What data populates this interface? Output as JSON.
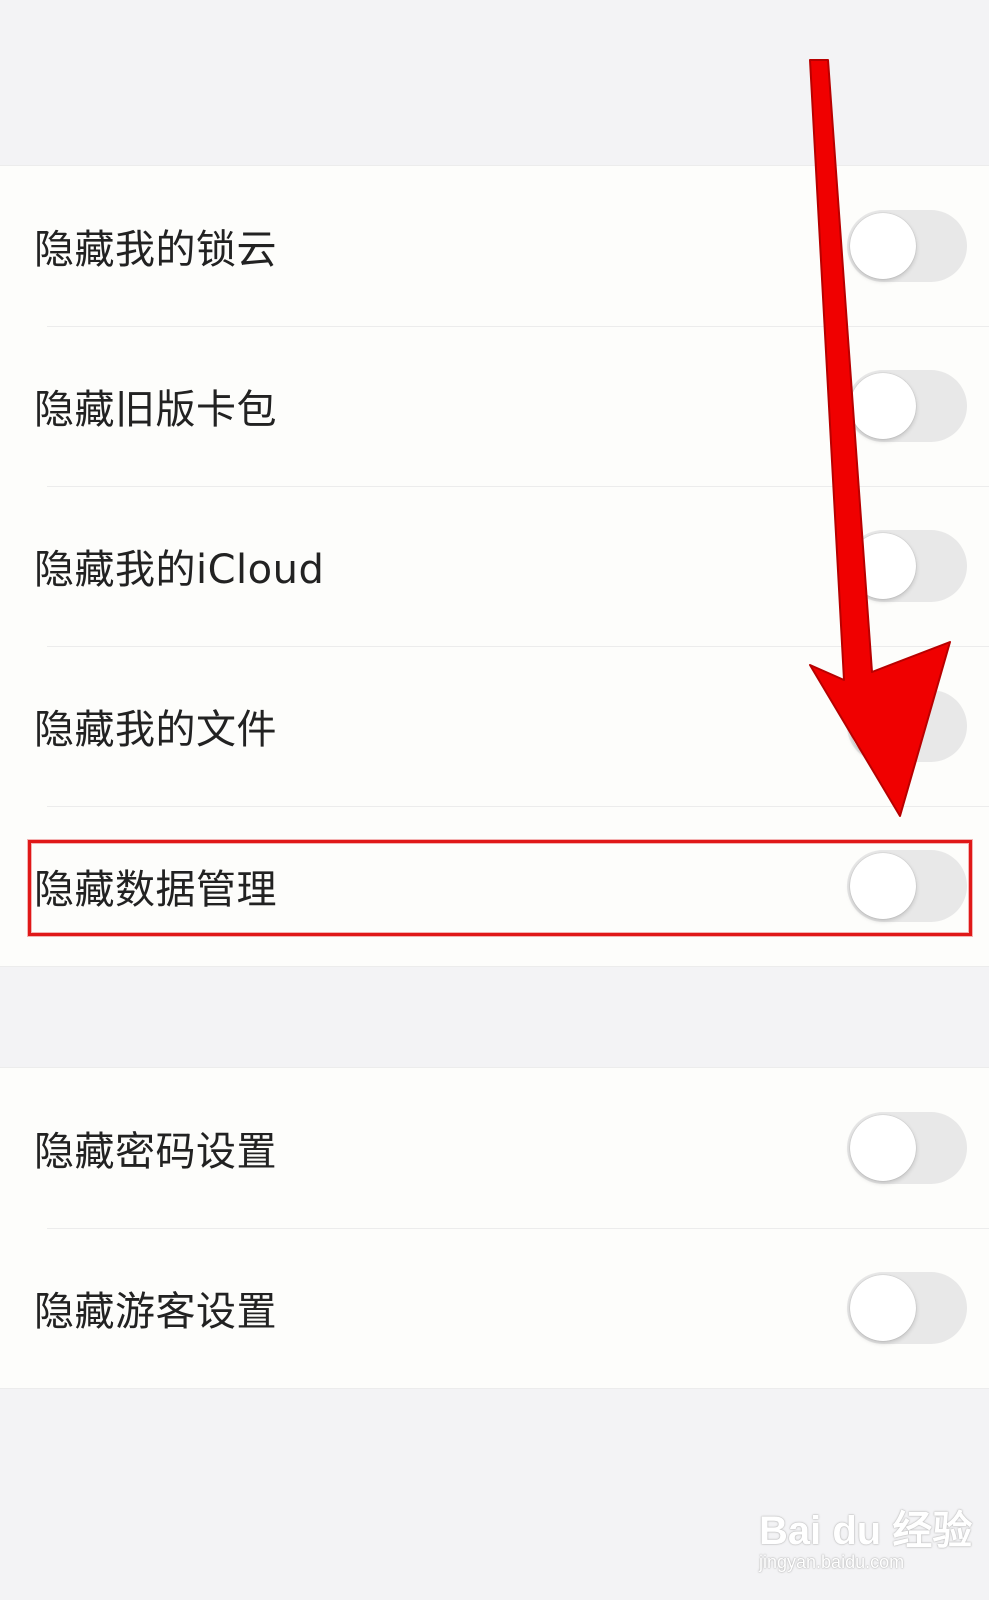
{
  "groups": [
    {
      "rows": [
        {
          "label": "隐藏我的锁云",
          "toggle_on": false
        },
        {
          "label": "隐藏旧版卡包",
          "toggle_on": false
        },
        {
          "label": "隐藏我的iCloud",
          "toggle_on": false
        },
        {
          "label": "隐藏我的文件",
          "toggle_on": false
        },
        {
          "label": "隐藏数据管理",
          "toggle_on": false
        }
      ]
    },
    {
      "rows": [
        {
          "label": "隐藏密码设置",
          "toggle_on": false
        },
        {
          "label": "隐藏游客设置",
          "toggle_on": false
        }
      ]
    }
  ],
  "annotation": {
    "color": "#e01818",
    "highlighted_row": "隐藏数据管理"
  },
  "watermark": {
    "logo": "Bai du 经验",
    "site": "jingyan.baidu.com"
  },
  "colors": {
    "background": "#f3f3f5",
    "cell": "#fdfdfb",
    "toggle_off": "#e8e8e8",
    "text": "#222222"
  }
}
